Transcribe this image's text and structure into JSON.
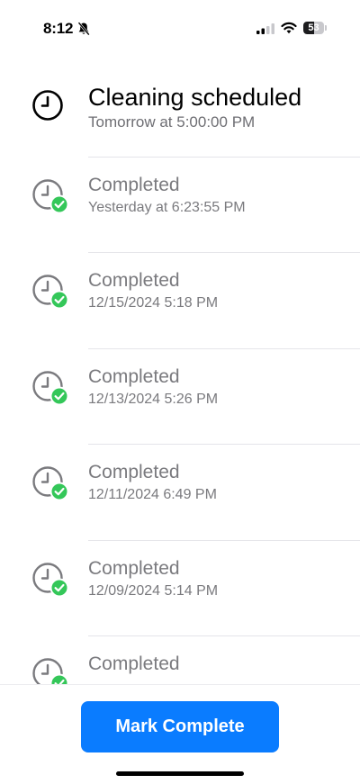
{
  "status_bar": {
    "time": "8:12",
    "battery_level": "53",
    "battery_fraction": 0.53
  },
  "history": {
    "items": [
      {
        "title": "Cleaning scheduled",
        "subtitle": "Tomorrow at 5:00:00 PM",
        "status": "scheduled",
        "icon": "clock-icon"
      },
      {
        "title": "Completed",
        "subtitle": "Yesterday at 6:23:55 PM",
        "status": "completed",
        "icon": "clock-check-icon"
      },
      {
        "title": "Completed",
        "subtitle": "12/15/2024 5:18 PM",
        "status": "completed",
        "icon": "clock-check-icon"
      },
      {
        "title": "Completed",
        "subtitle": "12/13/2024 5:26 PM",
        "status": "completed",
        "icon": "clock-check-icon"
      },
      {
        "title": "Completed",
        "subtitle": "12/11/2024 6:49 PM",
        "status": "completed",
        "icon": "clock-check-icon"
      },
      {
        "title": "Completed",
        "subtitle": "12/09/2024 5:14 PM",
        "status": "completed",
        "icon": "clock-check-icon"
      },
      {
        "title": "Completed",
        "subtitle": "",
        "status": "completed",
        "icon": "clock-check-icon"
      }
    ]
  },
  "actions": {
    "mark_complete_label": "Mark Complete"
  },
  "colors": {
    "accent": "#0a7cff",
    "check": "#34c759",
    "secondary_text": "#7a7a7e"
  }
}
